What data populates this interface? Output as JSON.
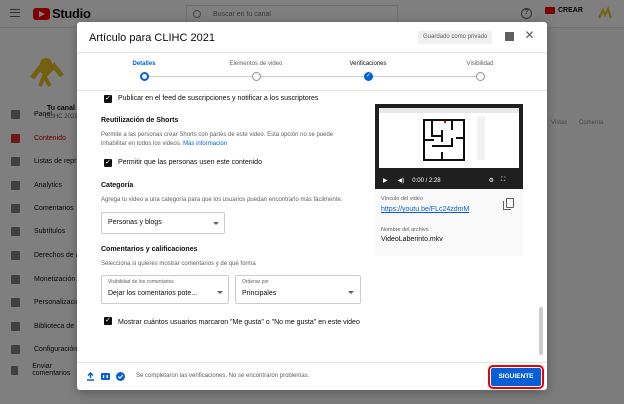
{
  "topbar": {
    "logo_text": "Studio",
    "search_placeholder": "Buscar en tu canal",
    "help_glyph": "?",
    "create_label": "CREAR"
  },
  "sidebar": {
    "channel_title": "Tu canal",
    "channel_name": "CLIHC 2021",
    "items": [
      {
        "label": "Panel",
        "active": false
      },
      {
        "label": "Contenido",
        "active": true
      },
      {
        "label": "Listas de repr",
        "active": false
      },
      {
        "label": "Analytics",
        "active": false
      },
      {
        "label": "Comentarios",
        "active": false
      },
      {
        "label": "Subtítulos",
        "active": false
      },
      {
        "label": "Derechos de a",
        "active": false
      },
      {
        "label": "Monetización",
        "active": false
      },
      {
        "label": "Personalizació",
        "active": false
      },
      {
        "label": "Biblioteca de",
        "active": false
      },
      {
        "label": "Configuración",
        "active": false
      },
      {
        "label": "Enviar comentarios",
        "active": false
      }
    ]
  },
  "background_columns": [
    "Vistas",
    "Comenta"
  ],
  "dialog": {
    "title": "Artículo para CLIHC 2021",
    "saved_badge": "Guardado como privado",
    "steps": [
      {
        "label": "Detalles",
        "state": "active"
      },
      {
        "label": "Elementos de video",
        "state": "pending"
      },
      {
        "label": "Verificaciones",
        "state": "done"
      },
      {
        "label": "Visibilidad",
        "state": "pending"
      }
    ],
    "feed_checkbox_label": "Publicar en el feed de suscripciones y notificar a los suscriptores",
    "shorts": {
      "title": "Reutilización de Shorts",
      "help": "Permite a las personas crear Shorts con partes de este video. Esta opción no se puede inhabilitar en todos los videos.",
      "link": "Más información",
      "checkbox_label": "Permitir que las personas usen este contenido"
    },
    "category": {
      "title": "Categoría",
      "help": "Agrega tu video a una categoría para que los usuarios puedan encontrarlo más fácilmente.",
      "value": "Personas y blogs"
    },
    "comments": {
      "title": "Comentarios y calificaciones",
      "help": "Selecciona si quieres mostrar comentarios y de qué forma",
      "visibility_label": "Visibilidad de los comentarios",
      "visibility_value": "Dejar los comentarios pote...",
      "sort_label": "Ordenar por",
      "sort_value": "Principales",
      "likes_checkbox_label": "Mostrar cuántos usuarios marcaron \"Me gusta\" o \"No me gusta\" en este video"
    },
    "video": {
      "time": "0:00 / 2:28",
      "link_label": "Vínculo del video",
      "link": "https://youtu.be/FLc24zdmM",
      "filename_label": "Nombre del archivo",
      "filename": "VideoLaberinto.mkv"
    },
    "footer_status": "Se completaron las verificaciones. No se encontraron problemas.",
    "next_label": "SIGUIENTE"
  },
  "colors": {
    "accent": "#065fd4",
    "brand": "#ff0000",
    "highlight_outline": "#ee0000"
  }
}
